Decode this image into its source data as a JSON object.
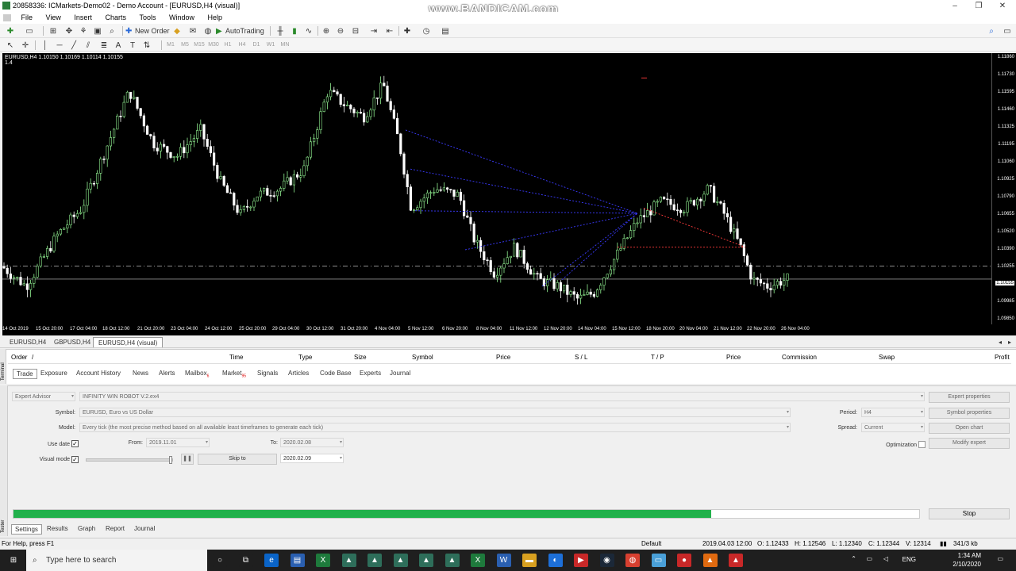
{
  "window": {
    "title": "20858336: ICMarkets-Demo02 - Demo Account - [EURUSD,H4 (visual)]",
    "watermark": "www.BANDICAM.com",
    "controls": [
      "–",
      "❐",
      "✕"
    ]
  },
  "menu": [
    "File",
    "View",
    "Insert",
    "Charts",
    "Tools",
    "Window",
    "Help"
  ],
  "toolbar": {
    "new_order": "New Order",
    "autotrading": "AutoTrading",
    "timeframes": [
      "M1",
      "M5",
      "M15",
      "M30",
      "H1",
      "H4",
      "D1",
      "W1",
      "MN"
    ]
  },
  "chart": {
    "info": "EURUSD,H4  1.10150 1.10169 1.10114 1.10155",
    "info_sub": "1.4",
    "price_labels": [
      "1.11860",
      "1.11730",
      "1.11595",
      "1.11460",
      "1.11325",
      "1.11195",
      "1.11060",
      "1.10925",
      "1.10790",
      "1.10655",
      "1.10520",
      "1.10390",
      "1.10255",
      "1.10120",
      "1.09985",
      "1.09850"
    ],
    "current_price": "1.10155",
    "time_labels": [
      "14 Oct 2019",
      "15 Oct 20:00",
      "17 Oct 04:00",
      "18 Oct 12:00",
      "21 Oct 20:00",
      "23 Oct 04:00",
      "24 Oct 12:00",
      "25 Oct 20:00",
      "29 Oct 04:00",
      "30 Oct 12:00",
      "31 Oct 20:00",
      "4 Nov 04:00",
      "5 Nov 12:00",
      "6 Nov 20:00",
      "8 Nov 04:00",
      "11 Nov 12:00",
      "12 Nov 20:00",
      "14 Nov 04:00",
      "15 Nov 12:00",
      "18 Nov 20:00",
      "20 Nov 04:00",
      "21 Nov 12:00",
      "22 Nov 20:00",
      "26 Nov 04:00"
    ],
    "colors": {
      "bull": "#90ee90",
      "bear": "#ffffff",
      "bg": "#000000",
      "line_blue": "#3a3aff",
      "line_red": "#ff3b3b"
    }
  },
  "chart_tabs": [
    "EURUSD,H4",
    "GBPUSD,H4",
    "EURUSD,H4 (visual)"
  ],
  "terminal": {
    "side_label": "Terminal",
    "columns": [
      "Order",
      "/",
      "Time",
      "Type",
      "Size",
      "Symbol",
      "Price",
      "S / L",
      "T / P",
      "Price",
      "Commission",
      "Swap",
      "Profit"
    ],
    "tabs": [
      {
        "label": "Trade",
        "badge": ""
      },
      {
        "label": "Exposure",
        "badge": ""
      },
      {
        "label": "Account History",
        "badge": ""
      },
      {
        "label": "News",
        "badge": ""
      },
      {
        "label": "Alerts",
        "badge": ""
      },
      {
        "label": "Mailbox",
        "badge": "6"
      },
      {
        "label": "Market",
        "badge": "95"
      },
      {
        "label": "Signals",
        "badge": ""
      },
      {
        "label": "Articles",
        "badge": ""
      },
      {
        "label": "Code Base",
        "badge": ""
      },
      {
        "label": "Experts",
        "badge": ""
      },
      {
        "label": "Journal",
        "badge": ""
      }
    ]
  },
  "tester": {
    "side_label": "Tester",
    "type_value": "Expert Advisor",
    "expert_value": "INFINITY WIN ROBOT V.2.ex4",
    "symbol_label": "Symbol:",
    "symbol_value": "EURUSD, Euro vs US Dollar",
    "model_label": "Model:",
    "model_value": "Every tick (the most precise method based on all available least timeframes to generate each tick)",
    "use_date_label": "Use date",
    "from_label": "From:",
    "from_value": "2019.11.01",
    "to_label": "To:",
    "to_value": "2020.02.08",
    "visual_mode_label": "Visual mode",
    "skip_to_label": "Skip to",
    "skip_to_value": "2020.02.09",
    "period_label": "Period:",
    "period_value": "H4",
    "spread_label": "Spread:",
    "spread_value": "Current",
    "optimization_label": "Optimization",
    "buttons": [
      "Expert properties",
      "Symbol properties",
      "Open chart",
      "Modify expert"
    ],
    "progress_pct": 77,
    "stop_label": "Stop",
    "bottom_tabs": [
      "Settings",
      "Results",
      "Graph",
      "Report",
      "Journal"
    ],
    "pause_glyph": "❚❚"
  },
  "status": {
    "help": "For Help, press F1",
    "profile": "Default",
    "datetime": "2019.04.03 12:00",
    "open": "O: 1.12433",
    "high": "H: 1.12546",
    "low": "L: 1.12340",
    "close": "C: 1.12344",
    "volume": "V: 12314",
    "traffic": "341/3 kb"
  },
  "taskbar": {
    "search_placeholder": "Type here to search",
    "lang": "ENG",
    "time": "1:34 AM",
    "date": "2/10/2020",
    "apps": [
      "cortana",
      "task-view",
      "edge",
      "files",
      "excel",
      "mt4-a",
      "mt4-b",
      "mt4-c",
      "mt4-d",
      "mt4-e",
      "excel-2",
      "word",
      "folder",
      "teamviewer",
      "redapp",
      "steam",
      "chrome",
      "notes",
      "rec",
      "vlc",
      "red2"
    ]
  }
}
